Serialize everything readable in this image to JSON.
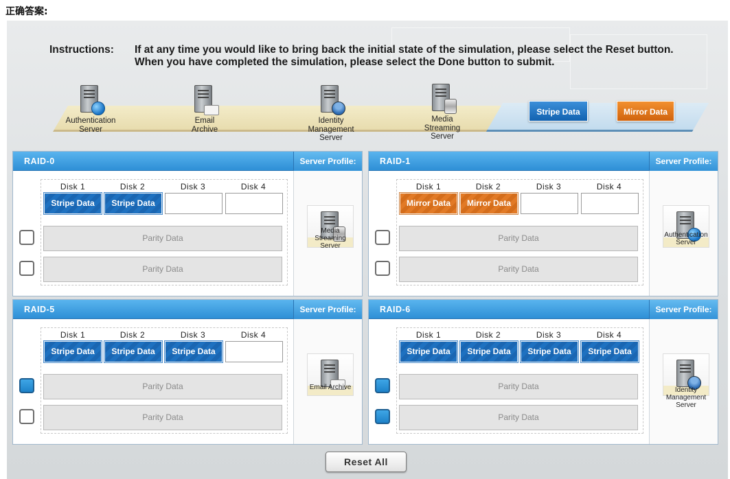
{
  "page": {
    "header": "正确答案:"
  },
  "instructions": {
    "label": "Instructions:",
    "text": "If at any time you would like to bring back the initial state of the simulation, please select the Reset button. When you have completed the simulation, please select the Done button to submit."
  },
  "servers": [
    {
      "label": "Authentication Server",
      "icon": "globe-server-icon"
    },
    {
      "label": "Email Archive",
      "icon": "mail-server-icon"
    },
    {
      "label": "Identity Management Server",
      "icon": "user-server-icon"
    },
    {
      "label": "Media Streaming Server",
      "icon": "database-server-icon"
    }
  ],
  "palette": {
    "stripe": "Stripe Data",
    "mirror": "Mirror Data"
  },
  "disk_headers": [
    "Disk 1",
    "Disk 2",
    "Disk 3",
    "Disk 4"
  ],
  "parity_label": "Parity Data",
  "server_profile_label": "Server Profile:",
  "raids": [
    {
      "title": "RAID-0",
      "disks": [
        "Stripe Data",
        "Stripe Data",
        "",
        ""
      ],
      "parity_checked": [
        false,
        false
      ],
      "profile": "Media Streaming Server"
    },
    {
      "title": "RAID-1",
      "disks": [
        "Mirror Data",
        "Mirror Data",
        "",
        ""
      ],
      "parity_checked": [
        false,
        false
      ],
      "profile": "Authentication Server"
    },
    {
      "title": "RAID-5",
      "disks": [
        "Stripe Data",
        "Stripe Data",
        "Stripe Data",
        ""
      ],
      "parity_checked": [
        true,
        false
      ],
      "profile": "Email Archive"
    },
    {
      "title": "RAID-6",
      "disks": [
        "Stripe Data",
        "Stripe Data",
        "Stripe Data",
        "Stripe Data"
      ],
      "parity_checked": [
        true,
        true
      ],
      "profile": "Identity Management Server"
    }
  ],
  "reset_label": "Reset All",
  "colors": {
    "raid_bar": "#2e8fd6",
    "stripe": "#1a66b2",
    "mirror": "#d46d1b",
    "checked": "#1d82c9"
  }
}
